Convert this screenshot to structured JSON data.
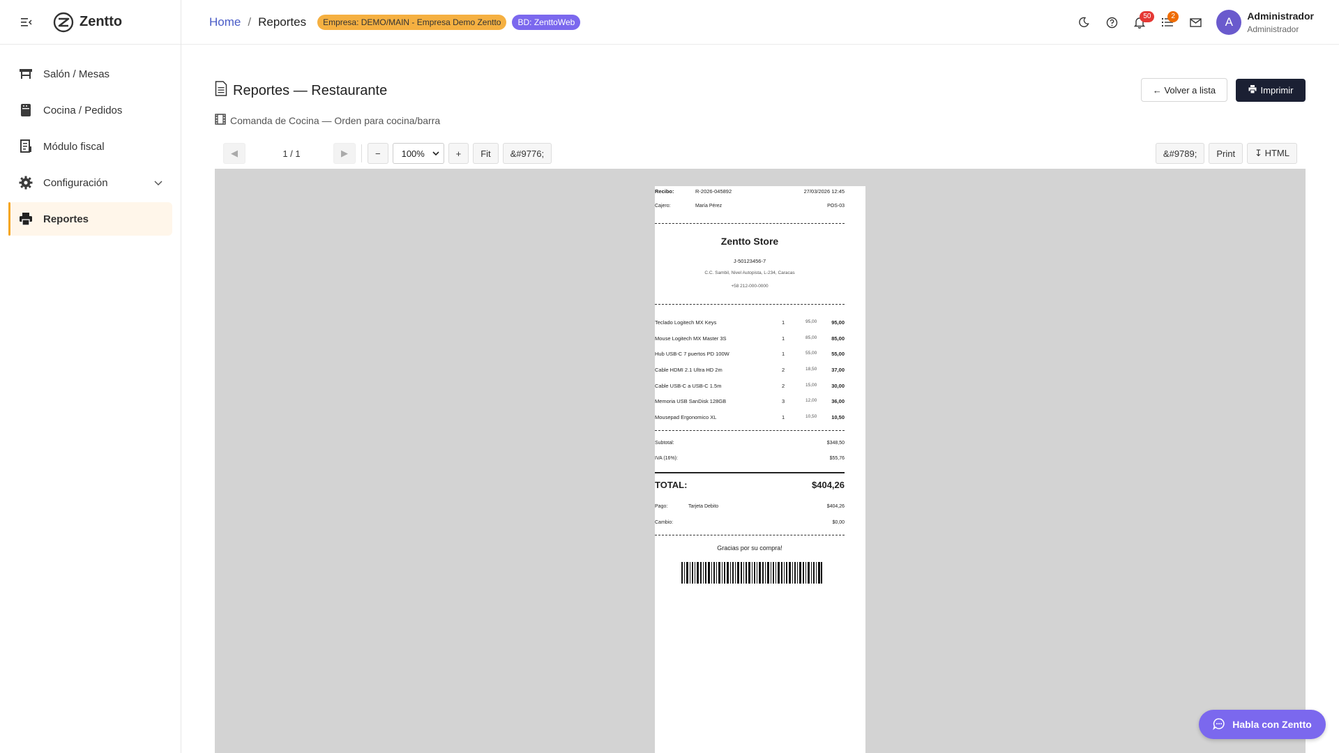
{
  "brand": {
    "name": "Zentto"
  },
  "sidebar": {
    "items": [
      {
        "label": "Salón / Mesas",
        "icon": "table-icon"
      },
      {
        "label": "Cocina / Pedidos",
        "icon": "kitchen-icon"
      },
      {
        "label": "Módulo fiscal",
        "icon": "receipt-icon"
      },
      {
        "label": "Configuración",
        "icon": "gear-icon"
      },
      {
        "label": "Reportes",
        "icon": "printer-icon"
      }
    ]
  },
  "topbar": {
    "breadcrumb": {
      "home": "Home",
      "sep": "/",
      "current": "Reportes"
    },
    "empresa_badge": "Empresa: DEMO/MAIN - Empresa Demo Zentto",
    "bd_badge": "BD: ZenttoWeb",
    "notifications_count": "50",
    "tasks_count": "2",
    "user": {
      "initial": "A",
      "name": "Administrador",
      "role": "Administrador"
    }
  },
  "page": {
    "title": "Reportes — Restaurante",
    "subtitle": "Comanda de Cocina — Orden para cocina/barra",
    "back_label": "← Volver a lista",
    "print_label": "Imprimir"
  },
  "viewer": {
    "prev": "◀",
    "next": "▶",
    "page_indicator": "1 / 1",
    "zoom_out": "−",
    "zoom": "100%",
    "zoom_in": "+",
    "fit": "Fit",
    "theme_btn": "&#9776;",
    "right_btn_1": "&#9789;",
    "right_btn_2": "Print",
    "right_btn_3": "↧ HTML"
  },
  "receipt": {
    "recibo_label": "Recibo:",
    "recibo_no": "R-2026-045892",
    "datetime": "27/03/2026 12:45",
    "cajero_label": "Cajero:",
    "cajero": "María Pérez",
    "pos": "POS-03",
    "store": "Zentto Store",
    "rif": "J-50123456-7",
    "address": "C.C. Sambil, Nivel Autopista, L-234, Caracas",
    "phone": "+58 212-000-0000",
    "items": [
      {
        "name": "Teclado Logitech MX Keys",
        "qty": "1",
        "price": "95,00",
        "total": "95,00"
      },
      {
        "name": "Mouse Logitech MX Master 3S",
        "qty": "1",
        "price": "85,00",
        "total": "85,00"
      },
      {
        "name": "Hub USB-C 7 puertos PD 100W",
        "qty": "1",
        "price": "55,00",
        "total": "55,00"
      },
      {
        "name": "Cable HDMI 2.1 Ultra HD 2m",
        "qty": "2",
        "price": "18,50",
        "total": "37,00"
      },
      {
        "name": "Cable USB-C a USB-C 1.5m",
        "qty": "2",
        "price": "15,00",
        "total": "30,00"
      },
      {
        "name": "Memoria USB SanDisk 128GB",
        "qty": "3",
        "price": "12,00",
        "total": "36,00"
      },
      {
        "name": "Mousepad Ergonomico XL",
        "qty": "1",
        "price": "10,50",
        "total": "10,50"
      }
    ],
    "subtotal_label": "Subtotal:",
    "subtotal": "$348,50",
    "iva_label": "IVA (16%):",
    "iva": "$55,76",
    "total_label": "TOTAL:",
    "total": "$404,26",
    "pago_label": "Pago:",
    "pago_method": "Tarjeta Debito",
    "pago": "$404,26",
    "cambio_label": "Cambio:",
    "cambio": "$0,00",
    "thanks": "Gracias por su compra!"
  },
  "chat": {
    "label": "Habla con Zentto"
  },
  "colors": {
    "accent": "#f5a623",
    "brand_purple": "#7b68ee",
    "badge_empresa": "#f5b041",
    "print_btn": "#1b2033",
    "canvas_bg": "#d3d3d3"
  }
}
